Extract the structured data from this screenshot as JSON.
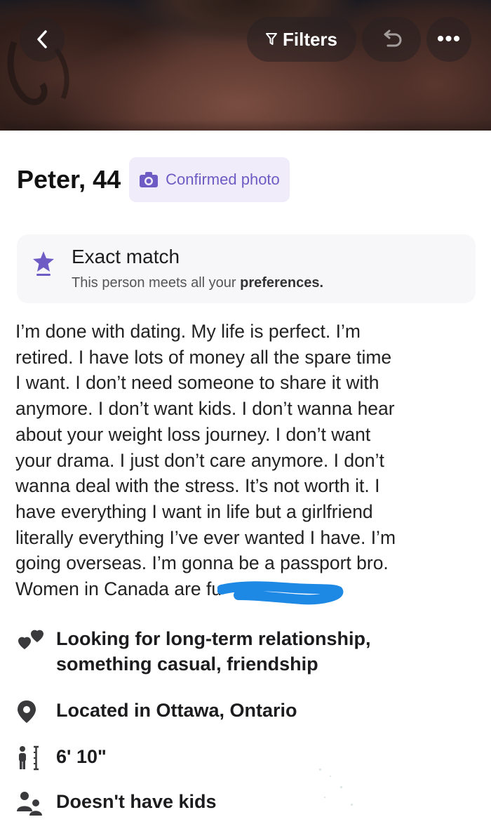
{
  "header": {
    "filters_label": "Filters",
    "back_icon": "chevron-left-icon",
    "undo_icon": "undo-icon",
    "more_label": "•••"
  },
  "profile": {
    "name_age": "Peter, 44",
    "confirmed_label": "Confirmed photo",
    "match_title": "Exact match",
    "match_subtitle_prefix": "This person meets all your ",
    "match_subtitle_bold": "preferences."
  },
  "bio_lines": [
    "I’m done with dating. My life is perfect. I’m",
    "retired. I have lots of money all the spare time",
    "I want. I don’t need someone to share it with",
    "anymore. I don’t want kids. I don’t wanna hear",
    "about your weight loss journey. I don’t want",
    "your drama. I just don’t care anymore. I don’t",
    "wanna deal with the stress. It’s not worth it. I",
    "have everything I want in life but a girlfriend",
    "literally everything I’ve ever wanted I have. I’m",
    "going overseas. I’m gonna be a passport bro.",
    "Women in Canada are fu"
  ],
  "details": {
    "looking_line1": "Looking for long-term relationship,",
    "looking_line2": "something casual, friendship",
    "location": "Located in Ottawa, Ontario",
    "height": "6' 10\"",
    "kids": "Doesn't have kids"
  },
  "colors": {
    "accent": "#6e5bc4",
    "scribble": "#1e88e5",
    "card_bg": "#f7f7fa"
  }
}
